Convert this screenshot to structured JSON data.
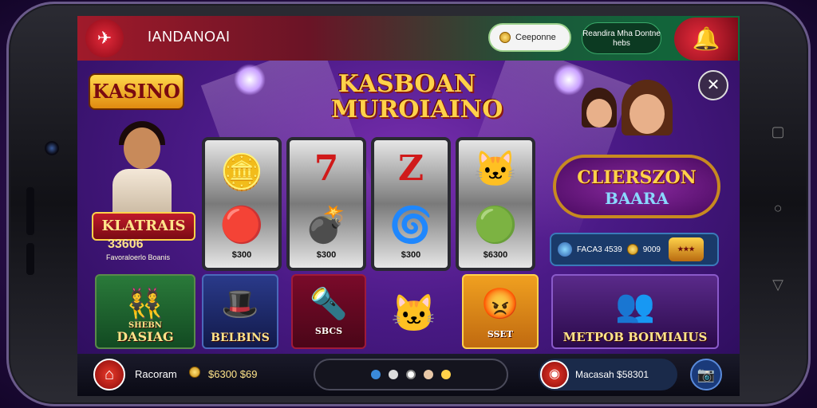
{
  "topbar": {
    "title": "IANDANOAI",
    "pill_label": "Ceeponne",
    "pill2_label": "Reandira Mha Dontne hebs"
  },
  "logo_text": "KASINO",
  "main_title": "KASBOAN MUROIAINO",
  "left_panel": {
    "banner": "KLATRAIS",
    "amount": "33606",
    "subtext": "Favoraloerlo Boanis"
  },
  "reels": [
    {
      "top_icon": "coin-icon",
      "bottom_icon": "red-fruit-icon",
      "price": "$300"
    },
    {
      "top_icon": "seven-icon",
      "bottom_icon": "bomb-icon",
      "price": "$300"
    },
    {
      "top_icon": "seven-icon",
      "bottom_icon": "coin-swirl-icon",
      "price": "$300"
    },
    {
      "top_icon": "cat-icon",
      "bottom_icon": "green-fruit-icon",
      "price": "$6300"
    }
  ],
  "right_panel": {
    "banner_line1": "CLIERSZON",
    "banner_line2": "BAARA",
    "stat_value": "FACA3 4539",
    "stat_value2": "9009"
  },
  "tiles": [
    {
      "label": "DASIAG",
      "sub": "SHEBN",
      "icon": "group-icon"
    },
    {
      "label": "BELBINS",
      "sub": "",
      "icon": "magician-icon"
    },
    {
      "label": "SBCS",
      "sub": "",
      "icon": "cannon-icon"
    },
    {
      "label": "",
      "sub": "",
      "icon": "cat-icon"
    },
    {
      "label": "SSET",
      "sub": "",
      "icon": "red-bird-icon"
    },
    {
      "label": "METPOB BOIMIAIUS",
      "sub": "",
      "icon": "crowd-icon"
    }
  ],
  "bottombar": {
    "label": "Racoram",
    "value": "$6300 $69",
    "right_label": "Macasah $58301"
  },
  "colors": {
    "accent_red": "#e62a3a",
    "gold": "#ffd24a",
    "purple_bg": "#4a1a86"
  }
}
